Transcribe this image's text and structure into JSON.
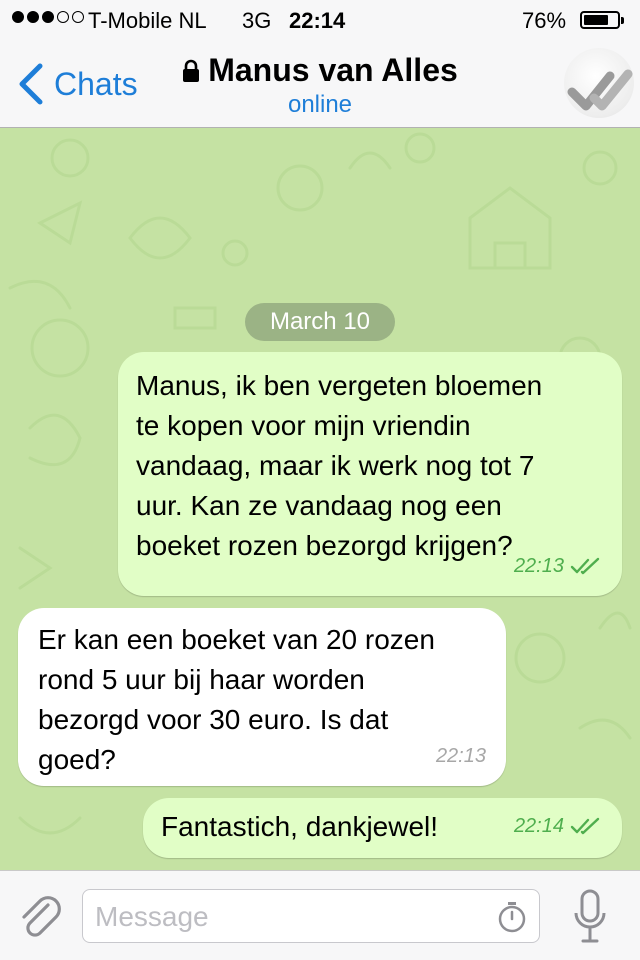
{
  "status_bar": {
    "carrier": "T-Mobile NL",
    "network": "3G",
    "time": "22:14",
    "battery_percent": "76%",
    "battery_level": 0.76,
    "signal_bars": 3,
    "signal_max": 5
  },
  "nav": {
    "back_label": "Chats",
    "contact_name": "Manus van Alles",
    "contact_status": "online",
    "back_icon": "chevron-left-icon",
    "lock_icon": "lock-icon"
  },
  "chat": {
    "date_label": "March 10",
    "messages": [
      {
        "direction": "outgoing",
        "text": "Manus, ik ben vergeten bloemen\nte kopen voor mijn vriendin\nvandaag, maar ik werk nog tot 7\nuur. Kan ze vandaag nog een\nboeket rozen bezorgd krijgen?",
        "time": "22:13",
        "read": true
      },
      {
        "direction": "incoming",
        "text": "Er kan een boeket van 20 rozen\nrond 5 uur bij haar worden\nbezorgd voor 30 euro. Is dat\ngoed?",
        "time": "22:13"
      },
      {
        "direction": "outgoing",
        "text": "Fantastich, dankjewel!",
        "time": "22:14",
        "read": true
      }
    ]
  },
  "input": {
    "placeholder": "Message",
    "value": ""
  },
  "colors": {
    "accent": "#1e7ed8",
    "chat_background": "#c5e2a3",
    "outgoing_bubble": "#e1fec6",
    "incoming_bubble": "#ffffff",
    "outgoing_time": "#4fae4e"
  }
}
